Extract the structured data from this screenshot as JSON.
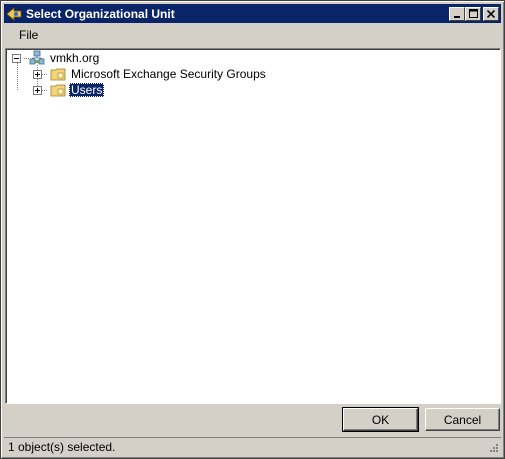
{
  "window": {
    "title": "Select Organizational Unit",
    "icon": "exchange-app-icon",
    "title_bar_color": "#0a246a"
  },
  "menu": {
    "items": [
      {
        "label": "File"
      }
    ]
  },
  "tree": {
    "root": {
      "label": "vmkh.org",
      "icon": "domain-icon",
      "expanded": true
    },
    "children": [
      {
        "label": "Microsoft Exchange Security Groups",
        "icon": "ou-folder-icon",
        "expanded": false,
        "selected": false
      },
      {
        "label": "Users",
        "icon": "ou-folder-icon",
        "expanded": false,
        "selected": true
      }
    ]
  },
  "buttons": {
    "ok_label": "OK",
    "cancel_label": "Cancel"
  },
  "status": {
    "text": "1 object(s) selected."
  },
  "colors": {
    "selection_bg": "#0a246a",
    "window_bg": "#d4d0c8"
  }
}
